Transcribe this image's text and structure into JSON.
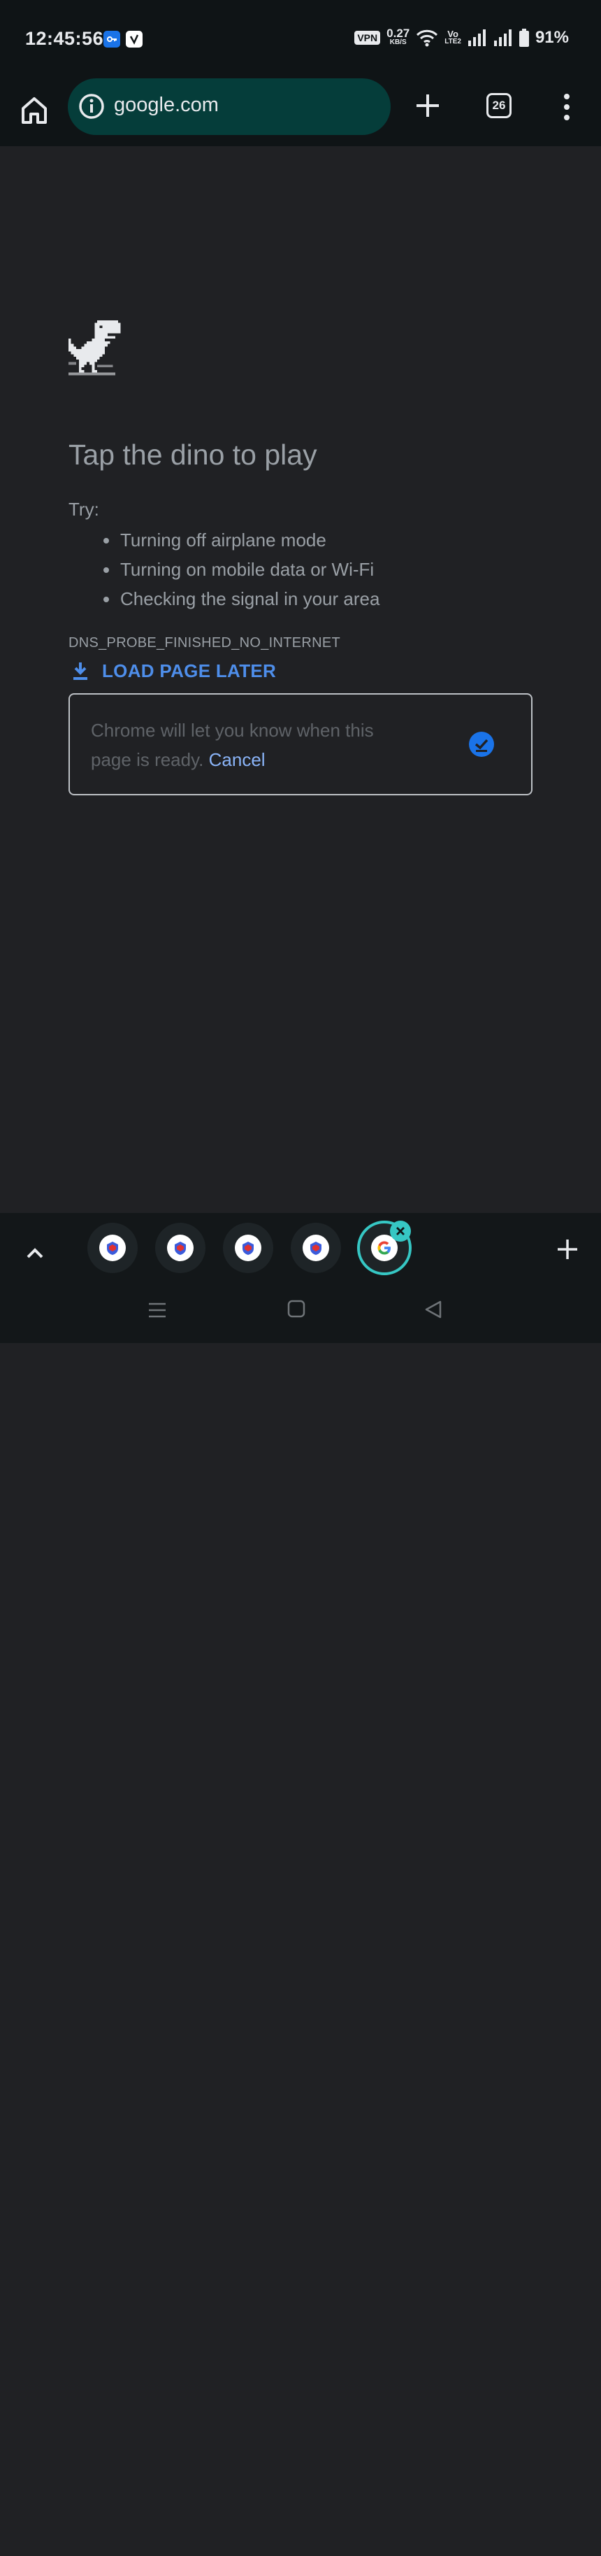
{
  "status_bar": {
    "time": "12:45:56",
    "vpn_label": "VPN",
    "net_speed": "0.27",
    "net_speed_unit": "KB/S",
    "volte_top": "Vo",
    "volte_bottom": "LTE2",
    "battery": "91%"
  },
  "toolbar": {
    "url": "google.com",
    "tab_count": "26"
  },
  "error_page": {
    "headline": "Tap the dino to play",
    "try_label": "Try:",
    "suggestions": [
      "Turning off airplane mode",
      "Turning on mobile data or Wi-Fi",
      "Checking the signal in your area"
    ],
    "error_code": "DNS_PROBE_FINISHED_NO_INTERNET",
    "load_later_label": "LOAD PAGE LATER",
    "notice_text": "Chrome will let you know when this page is ready.",
    "cancel_label": "Cancel"
  },
  "colors": {
    "accent_blue": "#4e8eea",
    "link_blue": "#8ab4f8",
    "omnibox_bg": "#053d3a",
    "active_tab_ring": "#36c7c4"
  },
  "icons": {
    "home": "home-icon",
    "info": "info-icon",
    "new_tab": "plus-icon",
    "menu": "more-vert-icon",
    "download": "download-icon",
    "ready": "ready-check-icon"
  }
}
